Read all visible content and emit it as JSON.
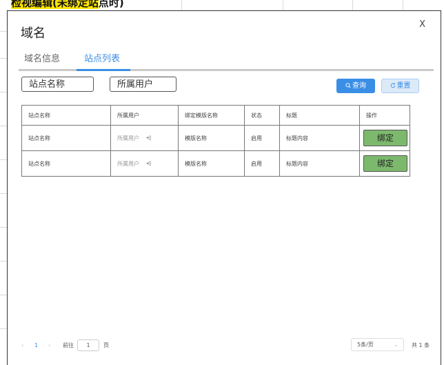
{
  "banner": {
    "highlighted": "检视编辑(未绑定站",
    "rest": "点时)"
  },
  "dialog": {
    "title": "域名",
    "close_label": "X",
    "tabs": [
      {
        "label": "域名信息",
        "active": false
      },
      {
        "label": "站点列表",
        "active": true
      }
    ],
    "filters": {
      "site_name_placeholder": "站点名称",
      "user_placeholder": "所属用户"
    },
    "buttons": {
      "query_icon": "search-icon",
      "query_label": "查询",
      "reset_icon": "refresh-icon",
      "reset_label": "重置"
    },
    "table": {
      "headers": [
        "站点名称",
        "所属用户",
        "绑定模版名称",
        "状态",
        "标题",
        "操作"
      ],
      "rows": [
        {
          "site_name": "站点名称",
          "user": "所属用户",
          "template": "模版名称",
          "status": "启用",
          "title": "标题内容",
          "action": "绑定"
        },
        {
          "site_name": "站点名称",
          "user": "所属用户",
          "template": "模版名称",
          "status": "启用",
          "title": "标题内容",
          "action": "绑定"
        }
      ]
    },
    "pagination": {
      "prev": "‹",
      "current_page": "1",
      "next": "›",
      "goto_label": "前往",
      "goto_value": "1",
      "goto_unit": "页",
      "page_size": "5条/页",
      "total": "共 1 条"
    }
  },
  "colors": {
    "accent": "#3a8ee6",
    "bind_button": "#7cb96d",
    "banner_highlight": "#ffe600"
  }
}
